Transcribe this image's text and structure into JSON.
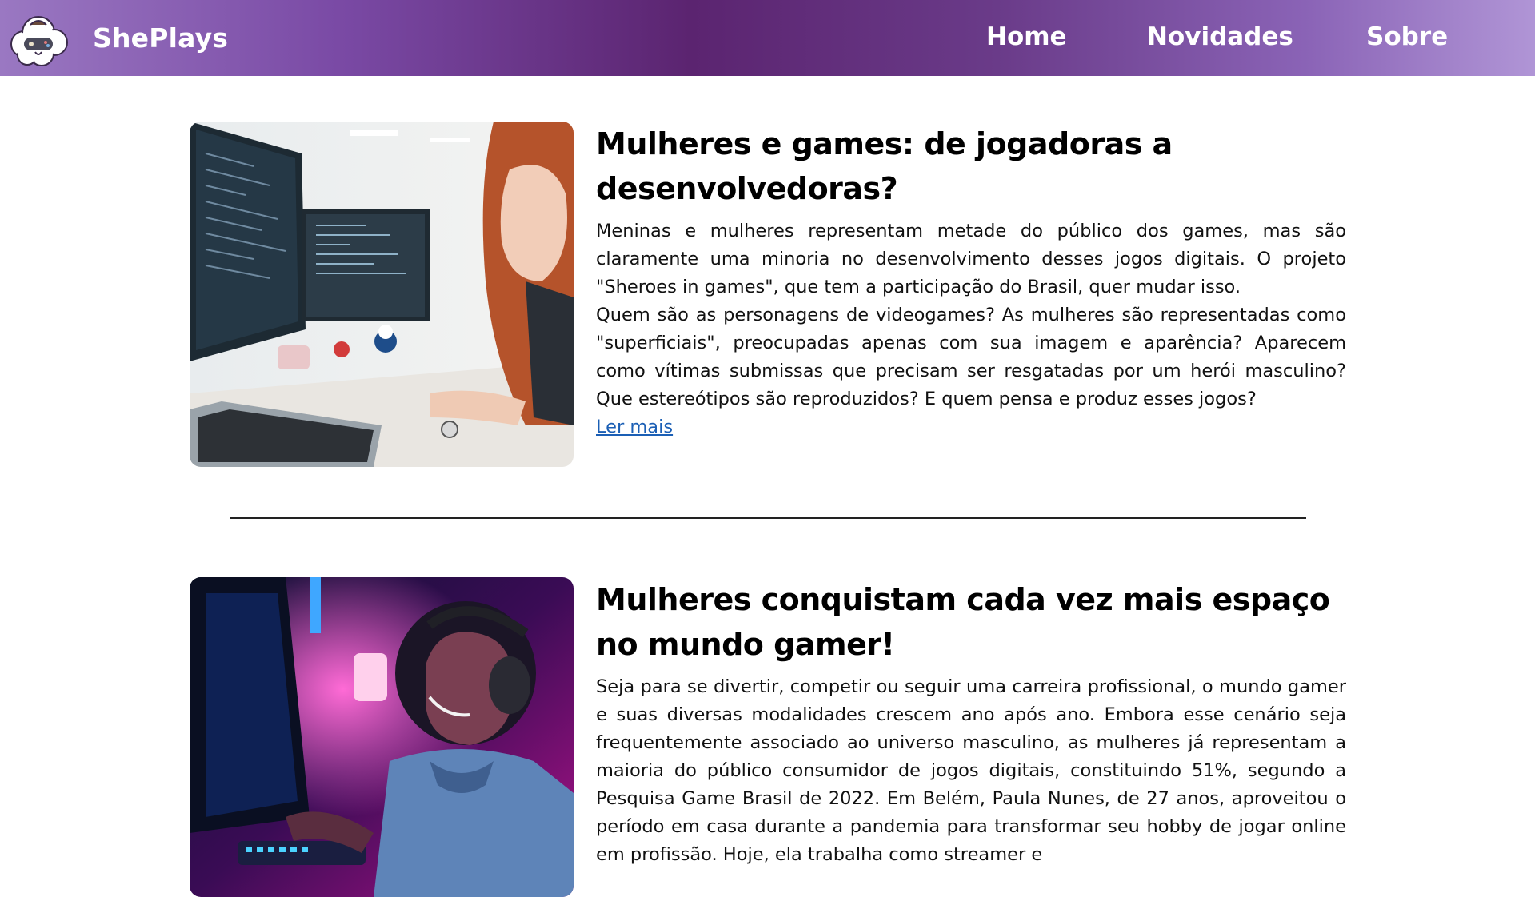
{
  "header": {
    "brand": "ShePlays",
    "logo_icon": "cloud-gamepad-icon",
    "nav": [
      {
        "label": "Home"
      },
      {
        "label": "Novidades"
      },
      {
        "label": "Sobre"
      }
    ],
    "gradient_colors": [
      "#9a78c2",
      "#5b2470",
      "#b095d6"
    ]
  },
  "articles": [
    {
      "title": "Mulheres e games: de jogadoras a desenvolvedoras?",
      "paragraph1": "Meninas e mulheres representam metade do público dos games, mas são claramente uma minoria no desenvolvimento desses jogos digitais. O projeto \"Sheroes in games\", que tem a participação do Brasil, quer mudar isso.",
      "paragraph2": "Quem são as personagens de videogames? As mulheres são representadas como \"superficiais\", preocupadas apenas com sua imagem e aparência? Aparecem como vítimas submissas que precisam ser resgatadas por um herói masculino? Que estereótipos são reproduzidos? E quem pensa e produz esses jogos?",
      "link": "Ler mais"
    },
    {
      "title": "Mulheres conquistam cada vez mais espaço no mundo gamer!",
      "paragraph1": "Seja para se divertir, competir ou seguir uma carreira profissional, o mundo gamer e suas diversas modalidades crescem ano após ano. Embora esse cenário seja frequentemente associado ao universo masculino, as mulheres já representam a maioria do público consumidor de jogos digitais, constituindo 51%, segundo a Pesquisa Game Brasil de 2022. Em Belém, Paula Nunes, de 27 anos, aproveitou o período em casa durante a pandemia para transformar seu hobby de jogar online em profissão. Hoje, ela trabalha como streamer e"
    }
  ]
}
